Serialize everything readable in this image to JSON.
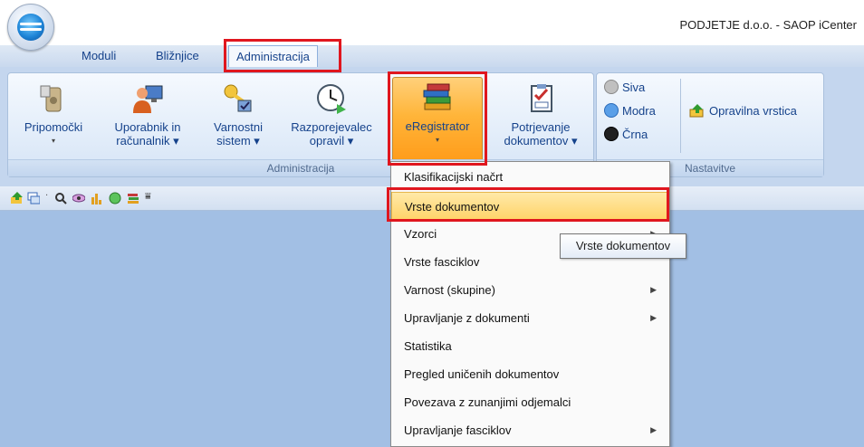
{
  "window": {
    "title": "PODJETJE d.o.o. - SAOP iCenter"
  },
  "tabs": [
    {
      "label": "Moduli"
    },
    {
      "label": "Bližnjice"
    },
    {
      "label": "Administracija"
    }
  ],
  "ribbon": {
    "groups": [
      {
        "label": "Administracija"
      },
      {
        "label": "Nastavitve"
      }
    ],
    "buttons": [
      {
        "line1": "Pripomočki",
        "line2": "▾",
        "icon": "tools-icon"
      },
      {
        "line1": "Uporabnik in",
        "line2": "računalnik ▾",
        "icon": "user-computer-icon"
      },
      {
        "line1": "Varnostni",
        "line2": "sistem ▾",
        "icon": "keys-icon"
      },
      {
        "line1": "Razporejevalec",
        "line2": "opravil ▾",
        "icon": "scheduler-clock-icon"
      },
      {
        "line1": "eRegistrator",
        "line2": "▾",
        "icon": "books-icon"
      },
      {
        "line1": "Potrjevanje",
        "line2": "dokumentov ▾",
        "icon": "checklist-icon"
      }
    ],
    "themes": [
      {
        "label": "Siva",
        "color": "#c0c0c0"
      },
      {
        "label": "Modra",
        "color": "#5a9fe8"
      },
      {
        "label": "Črna",
        "color": "#202020"
      }
    ],
    "taskbar_button": "Opravilna vrstica"
  },
  "dropdown": {
    "items": [
      {
        "label": "Klasifikacijski načrt",
        "submenu": false
      },
      {
        "label": "Vrste dokumentov",
        "submenu": false
      },
      {
        "label": "Vzorci",
        "submenu": true
      },
      {
        "label": "Vrste fasciklov",
        "submenu": false
      },
      {
        "label": "Varnost (skupine)",
        "submenu": true
      },
      {
        "label": "Upravljanje z dokumenti",
        "submenu": true
      },
      {
        "label": "Statistika",
        "submenu": false
      },
      {
        "label": "Pregled uničenih dokumentov",
        "submenu": false
      },
      {
        "label": "Povezava z zunanjimi odjemalci",
        "submenu": false
      },
      {
        "label": "Upravljanje fasciklov",
        "submenu": true
      }
    ],
    "submenu_arrow": "▶"
  },
  "tooltip": "Vrste dokumentov"
}
